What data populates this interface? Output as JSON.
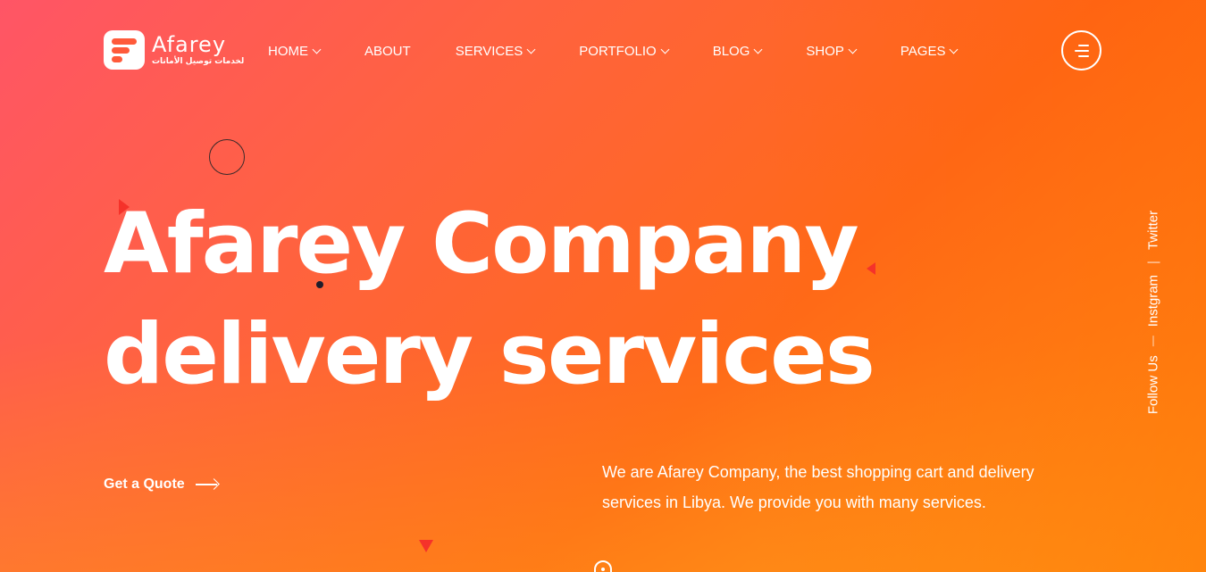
{
  "brand": {
    "name": "Afarey",
    "tagline": "لخدمات توصيل الأمانات"
  },
  "nav": {
    "items": [
      {
        "label": "HOME",
        "has_dropdown": true
      },
      {
        "label": "ABOUT",
        "has_dropdown": false
      },
      {
        "label": "SERVICES",
        "has_dropdown": true
      },
      {
        "label": "PORTFOLIO",
        "has_dropdown": true
      },
      {
        "label": "BLOG",
        "has_dropdown": true
      },
      {
        "label": "SHOP",
        "has_dropdown": true
      },
      {
        "label": "PAGES",
        "has_dropdown": true
      }
    ],
    "menu_icon": "hamburger-icon"
  },
  "hero": {
    "title_line1": "Afarey Company",
    "title_line2": "delivery services",
    "cta_label": "Get a Quote",
    "cta_icon": "arrow-right-icon",
    "description": "We are Afarey Company, the best shopping cart and delivery services in Libya. We provide you with many services."
  },
  "social": {
    "follow_label": "Follow Us",
    "links": [
      "Instgram",
      "Twitter"
    ],
    "separator": "|"
  },
  "colors": {
    "gradient_start": "#ff5566",
    "gradient_mid": "#ff6a18",
    "gradient_end": "#ff9d14",
    "accent_red": "#f5322a",
    "text": "#ffffff"
  }
}
